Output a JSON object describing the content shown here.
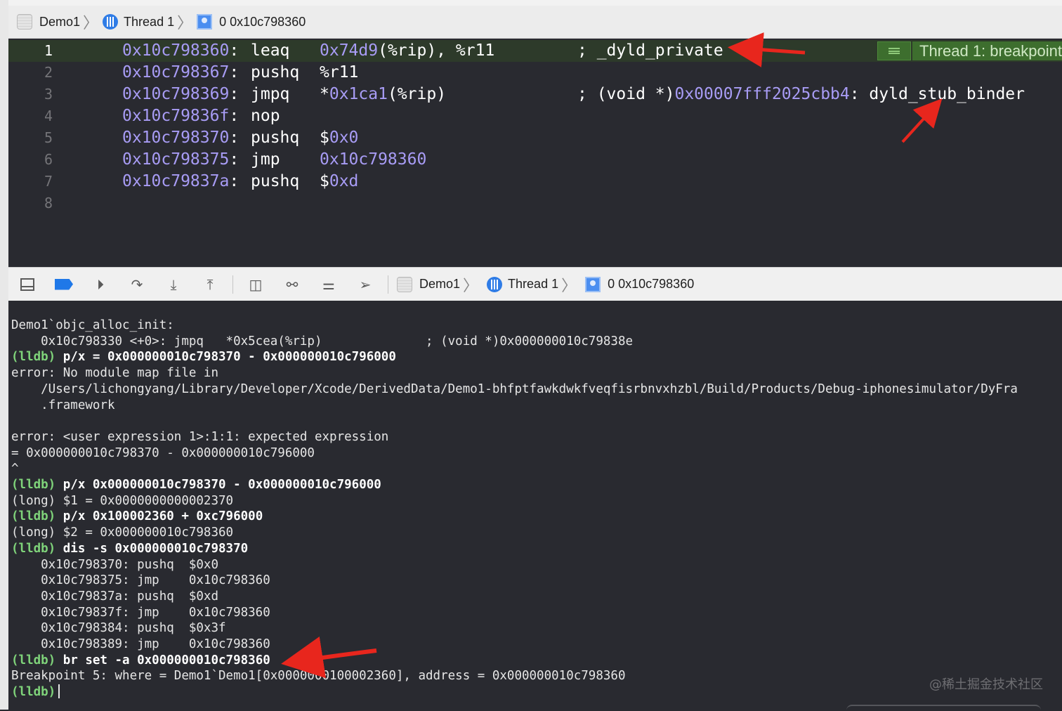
{
  "jump_bar": {
    "project": "Demo1",
    "thread": "Thread 1",
    "frame": "0 0x10c798360"
  },
  "disassembly": [
    {
      "ln": "1",
      "addr": "0x10c798360",
      "op": "leaq",
      "arg_num": "0x74d9",
      "arg_rest": "(%rip), %r11",
      "comment": "; _dyld_private",
      "comment_num": "",
      "comment_tail": "",
      "current": true
    },
    {
      "ln": "2",
      "addr": "0x10c798367",
      "op": "pushq",
      "arg_pre": "",
      "arg_num": "",
      "arg_rest": "%r11",
      "comment": "",
      "comment_num": "",
      "comment_tail": ""
    },
    {
      "ln": "3",
      "addr": "0x10c798369",
      "op": "jmpq",
      "arg_pre": "*",
      "arg_num": "0x1ca1",
      "arg_rest": "(%rip)",
      "comment": "; (void *)",
      "comment_num": "0x00007fff2025cbb4",
      "comment_tail": ": dyld_stub_binder"
    },
    {
      "ln": "4",
      "addr": "0x10c79836f",
      "op": "nop",
      "arg_pre": "",
      "arg_num": "",
      "arg_rest": "",
      "comment": "",
      "comment_num": "",
      "comment_tail": ""
    },
    {
      "ln": "5",
      "addr": "0x10c798370",
      "op": "pushq",
      "arg_pre": "$",
      "arg_num": "0x0",
      "arg_rest": "",
      "comment": "",
      "comment_num": "",
      "comment_tail": ""
    },
    {
      "ln": "6",
      "addr": "0x10c798375",
      "op": "jmp",
      "arg_pre": "",
      "arg_num": "0x10c798360",
      "arg_rest": "",
      "comment": "",
      "comment_num": "",
      "comment_tail": ""
    },
    {
      "ln": "7",
      "addr": "0x10c79837a",
      "op": "pushq",
      "arg_pre": "$",
      "arg_num": "0xd",
      "arg_rest": "",
      "comment": "",
      "comment_num": "",
      "comment_tail": ""
    },
    {
      "ln": "8",
      "addr": "",
      "op": "",
      "arg_pre": "",
      "arg_num": "",
      "arg_rest": "",
      "comment": "",
      "comment_num": "",
      "comment_tail": ""
    }
  ],
  "breakpoint_badge": "Thread 1: breakpoint",
  "debug_bar": {
    "project": "Demo1",
    "thread": "Thread 1",
    "frame": "0 0x10c798360",
    "icons": [
      "hide-debug-area-icon",
      "breakpoints-toggle-icon",
      "continue-icon",
      "step-over-icon",
      "step-into-icon",
      "step-out-icon",
      "view-hierarchy-icon",
      "memory-graph-icon",
      "environment-overrides-icon",
      "simulate-location-icon"
    ]
  },
  "console": {
    "lines": [
      {
        "prompt": "",
        "cmd": "",
        "text": "Demo1`objc_alloc_init:"
      },
      {
        "prompt": "",
        "cmd": "",
        "text": "    0x10c798330 <+0>: jmpq   *0x5cea(%rip)              ; (void *)0x000000010c79838e"
      },
      {
        "prompt": "(lldb)",
        "cmd": " p/x = 0x000000010c798370 - 0x000000010c796000",
        "text": ""
      },
      {
        "prompt": "",
        "cmd": "",
        "text": "error: No module map file in"
      },
      {
        "prompt": "",
        "cmd": "",
        "text": "    /Users/lichongyang/Library/Developer/Xcode/DerivedData/Demo1-bhfptfawkdwkfveqfisrbnvxhzbl/Build/Products/Debug-iphonesimulator/DyFra"
      },
      {
        "prompt": "",
        "cmd": "",
        "text": "    .framework"
      },
      {
        "prompt": "",
        "cmd": "",
        "text": ""
      },
      {
        "prompt": "",
        "cmd": "",
        "text": "error: <user expression 1>:1:1: expected expression"
      },
      {
        "prompt": "",
        "cmd": "",
        "text": "= 0x000000010c798370 - 0x000000010c796000"
      },
      {
        "prompt": "",
        "cmd": "",
        "text": "^"
      },
      {
        "prompt": "(lldb)",
        "cmd": " p/x 0x000000010c798370 - 0x000000010c796000",
        "text": ""
      },
      {
        "prompt": "",
        "cmd": "",
        "text": "(long) $1 = 0x0000000000002370"
      },
      {
        "prompt": "(lldb)",
        "cmd": " p/x 0x100002360 + 0xc796000",
        "text": ""
      },
      {
        "prompt": "",
        "cmd": "",
        "text": "(long) $2 = 0x000000010c798360"
      },
      {
        "prompt": "(lldb)",
        "cmd": " dis -s 0x000000010c798370",
        "text": ""
      },
      {
        "prompt": "",
        "cmd": "",
        "text": "    0x10c798370: pushq  $0x0"
      },
      {
        "prompt": "",
        "cmd": "",
        "text": "    0x10c798375: jmp    0x10c798360"
      },
      {
        "prompt": "",
        "cmd": "",
        "text": "    0x10c79837a: pushq  $0xd"
      },
      {
        "prompt": "",
        "cmd": "",
        "text": "    0x10c79837f: jmp    0x10c798360"
      },
      {
        "prompt": "",
        "cmd": "",
        "text": "    0x10c798384: pushq  $0x3f"
      },
      {
        "prompt": "",
        "cmd": "",
        "text": "    0x10c798389: jmp    0x10c798360"
      },
      {
        "prompt": "(lldb)",
        "cmd": " br set -a 0x000000010c798360",
        "text": ""
      },
      {
        "prompt": "",
        "cmd": "",
        "text": "Breakpoint 5: where = Demo1`Demo1[0x0000000100002360], address = 0x000000010c798360"
      },
      {
        "prompt": "(lldb)",
        "cmd": "",
        "text": "",
        "cursor": true
      }
    ]
  },
  "watermark": "@稀土掘金技术社区",
  "colors": {
    "editor_bg": "#292a30",
    "address_purple": "#a89cf5",
    "prompt_green": "#7fd37a",
    "current_line_bg": "#2d3a2a",
    "breakpoint_badge_bg": "#3d6e2e",
    "annotation_arrow_red": "#e8261d"
  }
}
